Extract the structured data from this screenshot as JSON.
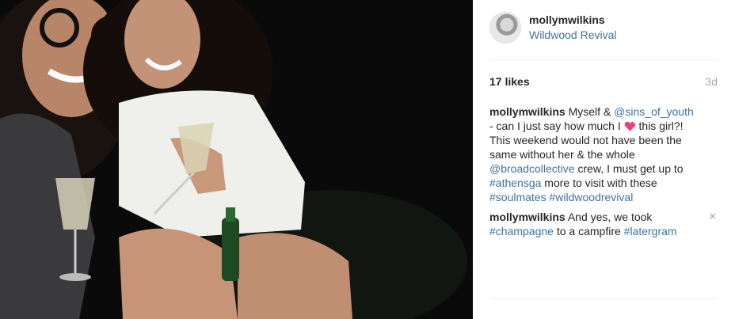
{
  "post": {
    "username": "mollymwilkins",
    "location": "Wildwood Revival",
    "likes": "17 likes",
    "time": "3d"
  },
  "caption": {
    "username": "mollymwilkins",
    "part1": " Myself & ",
    "mention1": "@sins_of_youth",
    "part2": " - can I just say how much I ",
    "part3": " this girl?! This weekend would not have been the same without her & the whole ",
    "mention2": "@broadcollective",
    "part4": " crew, I must get up to ",
    "tag1": "#athensga",
    "part5": " more to visit with these ",
    "tag2": "#soulmates",
    "part6": " ",
    "tag3": "#wildwoodrevival"
  },
  "comment2": {
    "username": "mollymwilkins",
    "part1": " And yes, we took ",
    "tag1": "#champagne",
    "part2": " to a campfire ",
    "tag2": "#latergram"
  },
  "icons": {
    "close": "×",
    "heart_emoji": "sparkling-heart-icon",
    "avatar": "profile-avatar"
  },
  "colors": {
    "link": "#3f729b",
    "text": "#262626",
    "muted": "#a5a7aa",
    "divider": "#efefef",
    "heart": "#e8407a"
  }
}
